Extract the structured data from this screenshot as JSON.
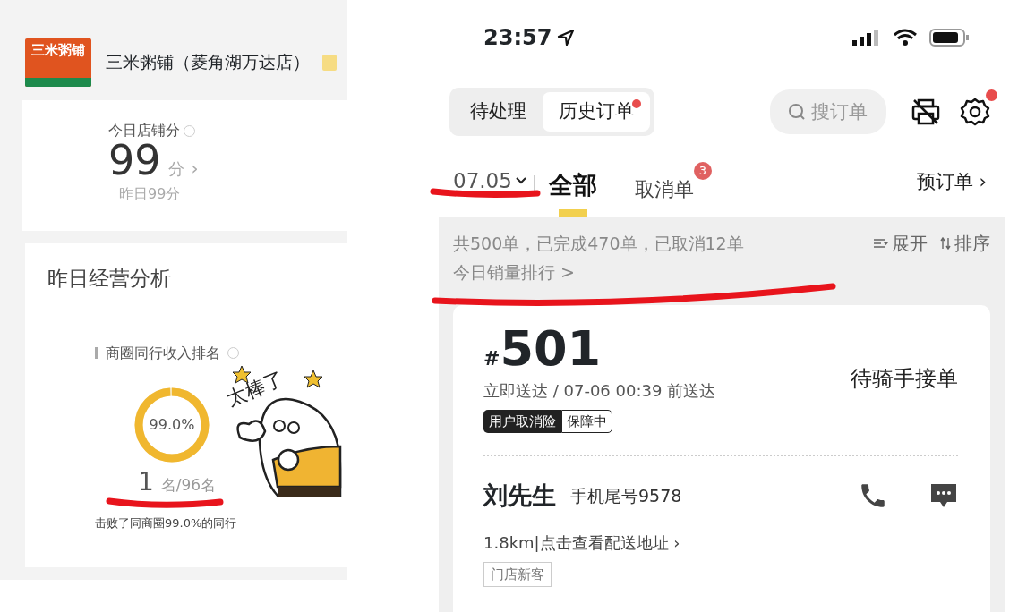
{
  "left_screen": {
    "store": {
      "logo_text": "三米粥铺",
      "name": "三米粥铺（菱角湖万达店）"
    },
    "score": {
      "label": "今日店铺分",
      "value": "99",
      "unit": "分",
      "arrow": "›",
      "yesterday": "昨日99分"
    },
    "analysis": {
      "title": "昨日经营分析",
      "rank_title": "商圈同行收入排名",
      "ring": {
        "level": 0.99,
        "text": "99.0%"
      },
      "rank": "1",
      "rank_total": "名/96名",
      "beaten": "击败了同商圈99.0%的同行",
      "sticker_caption": "太棒了"
    }
  },
  "right_screen": {
    "status_bar": {
      "time": "23:57"
    },
    "segments": [
      {
        "label": "待处理",
        "selected": false,
        "dot": false
      },
      {
        "label": "历史订单",
        "selected": true,
        "dot": true
      }
    ],
    "search": {
      "placeholder": "搜订单"
    },
    "settings_dot": true,
    "date": "07.05",
    "tabs": [
      {
        "label": "全部",
        "selected": true
      },
      {
        "label": "取消单",
        "selected": false,
        "badge": "3"
      }
    ],
    "preorder": "预订单 ›",
    "summary": "共500单，已完成470单，已取消12单",
    "ranking_link": "今日销量排行 >",
    "expand": "展开",
    "sort": "排序",
    "order": {
      "number": "501",
      "hash": "#",
      "delivery": "立即送达 / 07-06 00:39 前送达",
      "status": "待骑手接单",
      "insurance": "用户取消险",
      "insurance_state": "保障中",
      "customer": "刘先生",
      "phone": "手机尾号9578",
      "address_link": "1.8km|点击查看配送地址 ›",
      "tags": [
        "门店新客"
      ]
    }
  }
}
